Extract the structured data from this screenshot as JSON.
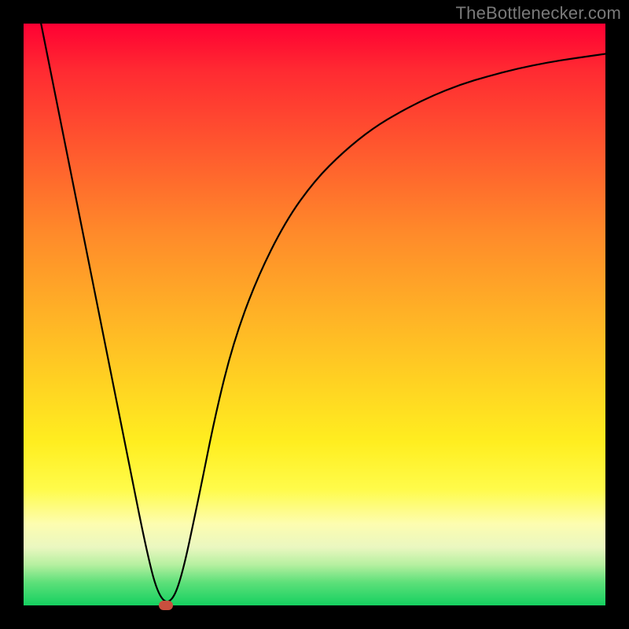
{
  "watermark": "TheBottlenecker.com",
  "chart_data": {
    "type": "line",
    "title": "",
    "xlabel": "",
    "ylabel": "",
    "xlim": [
      0,
      100
    ],
    "ylim": [
      0,
      100
    ],
    "x": [
      3,
      6,
      9,
      12,
      15,
      18,
      21,
      23,
      25,
      27,
      30,
      33,
      36,
      40,
      45,
      50,
      55,
      60,
      65,
      70,
      75,
      80,
      85,
      90,
      95,
      100
    ],
    "values": [
      100,
      85,
      70,
      55,
      40,
      25,
      10,
      2,
      0,
      4,
      18,
      33,
      45,
      56,
      66,
      73,
      78,
      82,
      85,
      87.5,
      89.5,
      91,
      92.3,
      93.3,
      94.1,
      94.8
    ],
    "marker": {
      "x": 24.5,
      "y": 0
    },
    "gradient_stops": [
      {
        "pos": 0,
        "color": "#ff0033"
      },
      {
        "pos": 50,
        "color": "#ffb226"
      },
      {
        "pos": 80,
        "color": "#fffb4a"
      },
      {
        "pos": 100,
        "color": "#15d060"
      }
    ]
  }
}
